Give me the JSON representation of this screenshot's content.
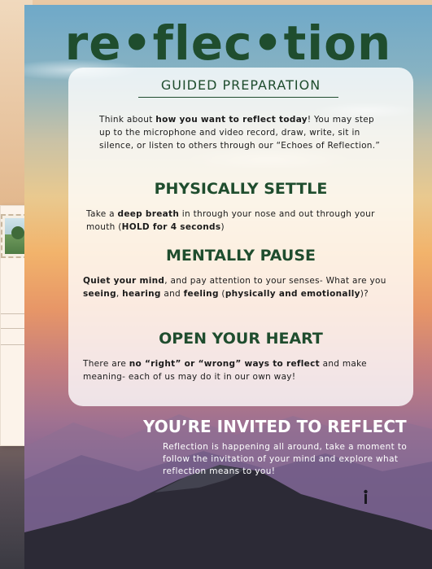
{
  "poster": {
    "title": "re•flec•tion",
    "subtitle": "GUIDED PREPARATION",
    "intro": {
      "p1": "Think about ",
      "b1": "how you want to reflect today",
      "p2": "! You may step up to the microphone and video record, draw, write, sit in silence, or listen to others through our “Echoes of Reflection.”"
    },
    "settle": {
      "heading": "PHYSICALLY SETTLE",
      "p1": "Take a ",
      "b1": "deep breath",
      "p2": " in through your nose and out through your mouth (",
      "b2": "HOLD for 4 seconds",
      "p3": ")"
    },
    "pause": {
      "heading": "MENTALLY PAUSE",
      "b1": "Quiet your mind",
      "p1": ", and pay attention to your senses- What are you ",
      "b2": "seeing",
      "p2": ", ",
      "b3": "hearing",
      "p3": " and ",
      "b4": "feeling",
      "p4": " (",
      "b5": "physically and emotionally",
      "p5": ")?"
    },
    "heart": {
      "heading": "OPEN YOUR HEART",
      "p1": "There are ",
      "b1": "no “right” or “wrong” ways to reflect",
      "p2": " and make meaning- each of us may do it in our own way!"
    },
    "invite": {
      "heading": "YOU’RE INVITED TO REFLECT",
      "text": "Reflection is happening all around, take a moment to follow the invitation of your mind and explore what reflection means to you!"
    }
  },
  "colors": {
    "heading_green": "#1f4d2e",
    "invite_white": "#ffffff"
  }
}
